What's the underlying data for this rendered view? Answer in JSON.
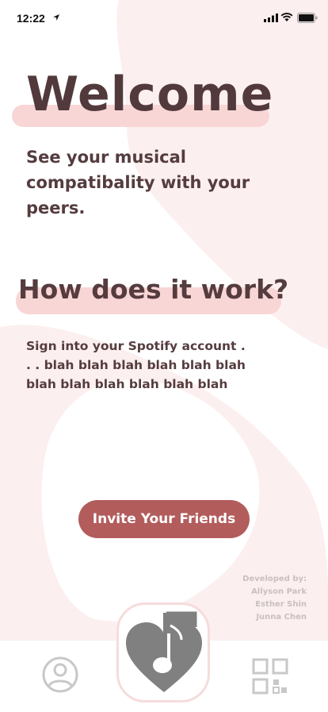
{
  "status_bar": {
    "time": "12:22"
  },
  "welcome": {
    "title": "Welcome",
    "subtitle": "See your musical compatibality with your peers."
  },
  "how": {
    "title": "How does it work?",
    "body": "Sign into your Spotify account . . . blah blah blah blah blah blah blah blah blah blah blah blah"
  },
  "invite_button": {
    "label": "Invite Your Friends"
  },
  "credits": {
    "heading": "Developed by:",
    "names": [
      "Allyson Park",
      "Esther Shin",
      "Junna Chen"
    ]
  },
  "tab_bar": {
    "tabs": [
      {
        "icon": "profile-icon"
      },
      {
        "icon": "music-heart-icon"
      },
      {
        "icon": "qr-grid-icon"
      }
    ]
  },
  "colors": {
    "accent": "#b35c5c",
    "highlight": "#f9d6d6",
    "text": "#553c3e",
    "background_blob": "#fcefef"
  }
}
